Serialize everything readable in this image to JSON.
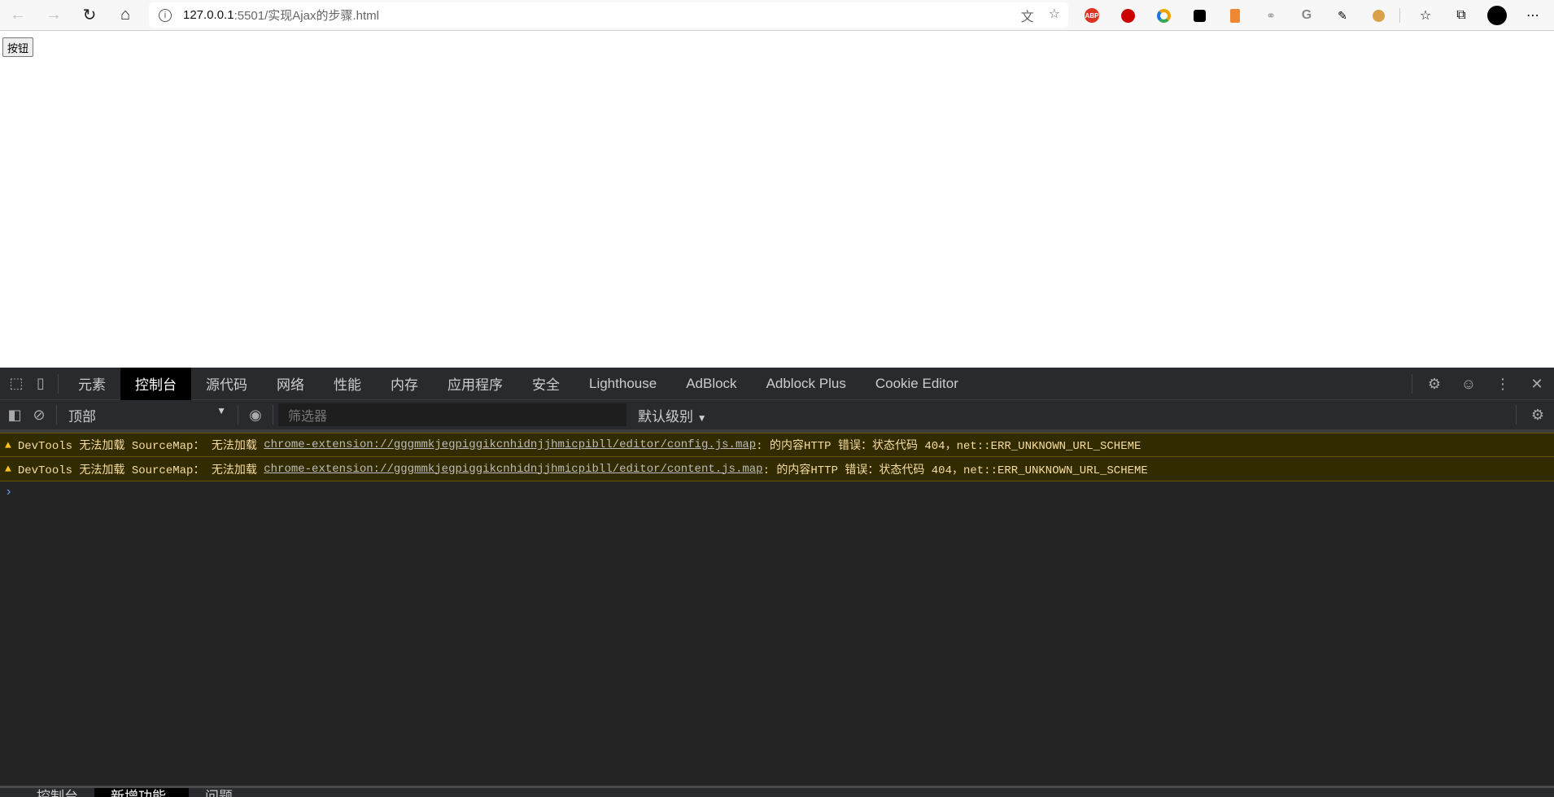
{
  "browser": {
    "url_host": "127.0.0.1",
    "url_path": ":5501/实现Ajax的步骤.html",
    "extensions": [
      "ABP",
      "uBlock",
      "Chrome",
      "Tampermonkey",
      "Office",
      "Link",
      "Grammarly",
      "Weibo",
      "Cookie"
    ]
  },
  "page": {
    "button_label": "按钮"
  },
  "devtools": {
    "tabs": [
      "元素",
      "控制台",
      "源代码",
      "网络",
      "性能",
      "内存",
      "应用程序",
      "安全",
      "Lighthouse",
      "AdBlock",
      "Adblock Plus",
      "Cookie Editor"
    ],
    "context": "顶部",
    "filter_placeholder": "筛选器",
    "level": "默认级别",
    "messages": [
      {
        "prefix": "DevTools 无法加载 SourceMap： 无法加载 ",
        "link": "chrome-extension://gggmmkjegpiggikcnhidnjjhmicpibll/editor/config.js.map",
        "suffix": ": 的内容HTTP 错误：状态代码 404，net::ERR_UNKNOWN_URL_SCHEME"
      },
      {
        "prefix": "DevTools 无法加载 SourceMap： 无法加载 ",
        "link": "chrome-extension://gggmmkjegpiggikcnhidnjjhmicpibll/editor/content.js.map",
        "suffix": ": 的内容HTTP 错误：状态代码 404，net::ERR_UNKNOWN_URL_SCHEME"
      }
    ],
    "prompt": "›",
    "drawer_tabs": [
      "控制台",
      "新增功能",
      "问题"
    ]
  },
  "colors": {
    "warning_bg": "#332b00",
    "warning_text": "#f5dca0"
  }
}
